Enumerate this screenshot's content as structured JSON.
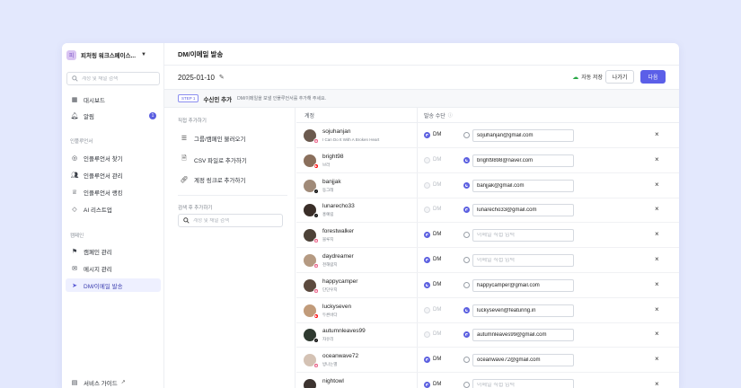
{
  "sidebar": {
    "workspace_logo": "피",
    "workspace_name": "피처링 워크스페이스...",
    "search_placeholder": "계정 및 채널 검색",
    "items_top": [
      {
        "label": "대시보드",
        "icon": "dashboard-icon"
      },
      {
        "label": "알림",
        "icon": "bell-icon",
        "badge": "1"
      }
    ],
    "section_influencer": "인플루언서",
    "items_influencer": [
      {
        "label": "인플루언서 찾기",
        "icon": "compass-icon"
      },
      {
        "label": "인플루언서 관리",
        "icon": "users-icon"
      },
      {
        "label": "인플루언서 랭킹",
        "icon": "trophy-icon"
      },
      {
        "label": "AI 리스트업",
        "icon": "diamond-icon"
      }
    ],
    "section_campaign": "캠페인",
    "items_campaign": [
      {
        "label": "캠페인 관리",
        "icon": "flag-icon"
      },
      {
        "label": "메시지 관리",
        "icon": "mail-icon"
      },
      {
        "label": "DM/이메일 발송",
        "icon": "send-icon",
        "active": true
      }
    ],
    "footer_label": "서비스 가이드"
  },
  "main": {
    "title": "DM/이메일 발송",
    "date": "2025-01-10",
    "autosave": "자동 저장",
    "exit_label": "나가기",
    "next_label": "다음",
    "step_tag": "STEP 1",
    "step_title": "수신인 추가",
    "step_desc": "DM/이메일을 보낼 인플루언서를 추가해 주세요."
  },
  "add_panel": {
    "direct_label": "직접 추가하기",
    "options": [
      {
        "label": "그룹/캠페인 불러오기",
        "icon": "list-icon"
      },
      {
        "label": "CSV 파일로 추가하기",
        "icon": "file-icon"
      },
      {
        "label": "계정 링크로 추가하기",
        "icon": "link-icon"
      }
    ],
    "search_label": "검색 후 추가하기",
    "search_placeholder": "계정 및 채널 검색"
  },
  "table": {
    "col_account": "계정",
    "col_method": "발송 수단",
    "dm_label": "DM",
    "email_placeholder": "이메일 직접 입력",
    "rows": [
      {
        "id": "sojuhanjan",
        "name": "I Can Do It With A Broken Heart",
        "platform": "instagram",
        "avatar": "#6b5a4e",
        "dm": "selected",
        "email": "sojuhanjan@gmail.com"
      },
      {
        "id": "bright98",
        "name": "브라",
        "platform": "youtube",
        "avatar": "#8a6f5c",
        "dm": "disabled",
        "email": "bright9898@naver.com"
      },
      {
        "id": "banjjak",
        "name": "동그레",
        "platform": "tiktok",
        "avatar": "#a08a78",
        "dm": "disabled",
        "email": "banjjak@gmail.com"
      },
      {
        "id": "lunarecho33",
        "name": "홍예림",
        "platform": "tiktok",
        "avatar": "#3a2e28",
        "dm": "disabled",
        "email": "lunarecho33@gmail.com"
      },
      {
        "id": "forestwalker",
        "name": "블루지",
        "platform": "instagram",
        "avatar": "#4d4238",
        "dm": "selected",
        "email": ""
      },
      {
        "id": "daydreamer",
        "name": "천해람지",
        "platform": "instagram",
        "avatar": "#b59a82",
        "dm": "selected",
        "email": ""
      },
      {
        "id": "happycamper",
        "name": "단단우지",
        "platform": "instagram",
        "avatar": "#5c4a3e",
        "dm": "selected",
        "email": "happycamper@gmail.com"
      },
      {
        "id": "luckyseven",
        "name": "두른바다",
        "platform": "youtube",
        "avatar": "#c19b7a",
        "dm": "disabled",
        "email": "luckyseven@featuring.in"
      },
      {
        "id": "autumnleaves99",
        "name": "자유리",
        "platform": "tiktok",
        "avatar": "#2f3a30",
        "dm": "disabled",
        "email": "autumnleaves99@gmail.com"
      },
      {
        "id": "oceanwave72",
        "name": "방나는별",
        "platform": "instagram",
        "avatar": "#d4c2b4",
        "dm": "selected",
        "email": "oceanwave72@gmail.com"
      },
      {
        "id": "nightowl",
        "name": "",
        "platform": "instagram",
        "avatar": "#3d3430",
        "dm": "selected",
        "email": ""
      }
    ]
  },
  "colors": {
    "accent": "#5b5fe8",
    "background": "#e3e8fd"
  }
}
